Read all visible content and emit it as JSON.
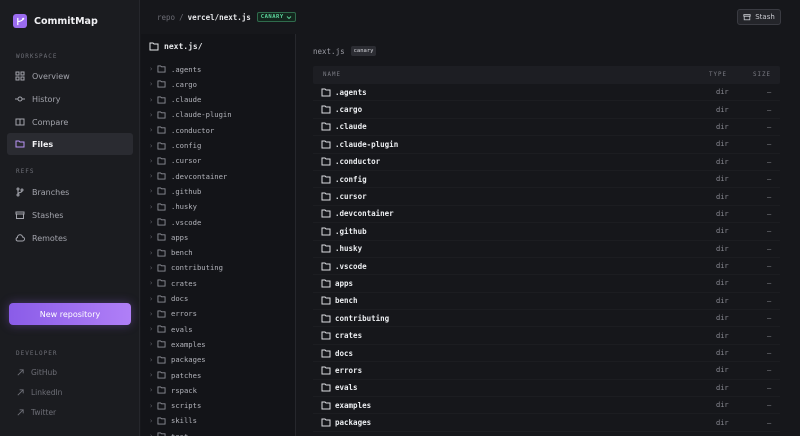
{
  "app": {
    "name": "CommitMap"
  },
  "sidebar": {
    "workspace_label": "WORKSPACE",
    "workspace_items": [
      {
        "label": "Overview",
        "icon": "grid-icon"
      },
      {
        "label": "History",
        "icon": "commit-icon"
      },
      {
        "label": "Compare",
        "icon": "compare-icon"
      },
      {
        "label": "Files",
        "icon": "folder-icon",
        "active": true
      }
    ],
    "refs_label": "REFS",
    "refs_items": [
      {
        "label": "Branches",
        "icon": "branch-icon"
      },
      {
        "label": "Stashes",
        "icon": "stash-icon"
      },
      {
        "label": "Remotes",
        "icon": "cloud-icon"
      }
    ],
    "new_repo_label": "New repository",
    "developer_label": "DEVELOPER",
    "developer_links": [
      {
        "label": "GitHub",
        "icon": "github-icon"
      },
      {
        "label": "LinkedIn",
        "icon": "linkedin-icon"
      },
      {
        "label": "Twitter",
        "icon": "twitter-icon"
      }
    ]
  },
  "topbar": {
    "repo_prefix": "repo",
    "separator": "/",
    "repo_name": "vercel/next.js",
    "branch": "CANARY",
    "stash_label": "Stash"
  },
  "tree": {
    "root": "next.js/",
    "items": [
      ".agents",
      ".cargo",
      ".claude",
      ".claude-plugin",
      ".conductor",
      ".config",
      ".cursor",
      ".devcontainer",
      ".github",
      ".husky",
      ".vscode",
      "apps",
      "bench",
      "contributing",
      "crates",
      "docs",
      "errors",
      "evals",
      "examples",
      "packages",
      "patches",
      "rspack",
      "scripts",
      "skills",
      "test"
    ]
  },
  "main": {
    "path": "next.js",
    "branch_tag": "canary",
    "columns": {
      "name": "NAME",
      "type": "TYPE",
      "size": "SIZE"
    },
    "rows": [
      {
        "name": ".agents",
        "type": "dir",
        "size": "—"
      },
      {
        "name": ".cargo",
        "type": "dir",
        "size": "—"
      },
      {
        "name": ".claude",
        "type": "dir",
        "size": "—"
      },
      {
        "name": ".claude-plugin",
        "type": "dir",
        "size": "—"
      },
      {
        "name": ".conductor",
        "type": "dir",
        "size": "—"
      },
      {
        "name": ".config",
        "type": "dir",
        "size": "—"
      },
      {
        "name": ".cursor",
        "type": "dir",
        "size": "—"
      },
      {
        "name": ".devcontainer",
        "type": "dir",
        "size": "—"
      },
      {
        "name": ".github",
        "type": "dir",
        "size": "—"
      },
      {
        "name": ".husky",
        "type": "dir",
        "size": "—"
      },
      {
        "name": ".vscode",
        "type": "dir",
        "size": "—"
      },
      {
        "name": "apps",
        "type": "dir",
        "size": "—"
      },
      {
        "name": "bench",
        "type": "dir",
        "size": "—"
      },
      {
        "name": "contributing",
        "type": "dir",
        "size": "—"
      },
      {
        "name": "crates",
        "type": "dir",
        "size": "—"
      },
      {
        "name": "docs",
        "type": "dir",
        "size": "—"
      },
      {
        "name": "errors",
        "type": "dir",
        "size": "—"
      },
      {
        "name": "evals",
        "type": "dir",
        "size": "—"
      },
      {
        "name": "examples",
        "type": "dir",
        "size": "—"
      },
      {
        "name": "packages",
        "type": "dir",
        "size": "—"
      }
    ]
  },
  "colors": {
    "accent": "#9b6cf0",
    "branch_green": "#5dd39b"
  }
}
